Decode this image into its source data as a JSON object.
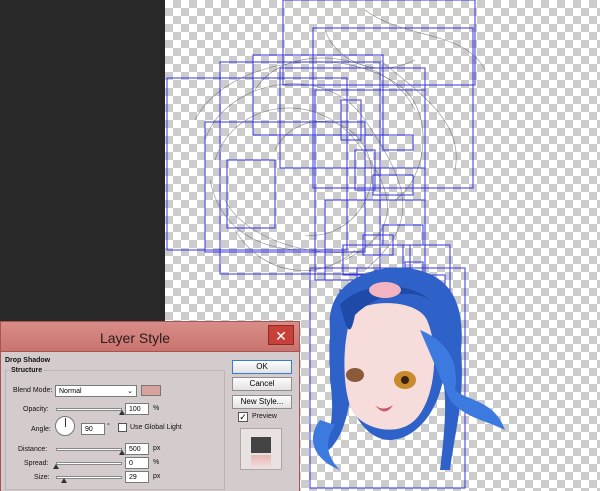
{
  "dialog": {
    "title": "Layer Style",
    "close_symbol": "✕",
    "section_title": "Drop Shadow",
    "group_title": "Structure",
    "blend_mode_label": "Blend Mode:",
    "blend_mode_value": "Normal",
    "shadow_color": "#d6a29b",
    "opacity_label": "Opacity:",
    "opacity_value": "100",
    "opacity_unit": "%",
    "opacity_level": 1.0,
    "angle_label": "Angle:",
    "angle_value": "90",
    "angle_unit": "°",
    "global_light_label": "Use Global Light",
    "distance_label": "Distance:",
    "distance_value": "500",
    "distance_unit": "px",
    "distance_level": 1.0,
    "spread_label": "Spread:",
    "spread_value": "0",
    "spread_unit": "%",
    "spread_level": 0.0,
    "size_label": "Size:",
    "size_value": "29",
    "size_unit": "px",
    "size_level": 0.12,
    "ok_label": "OK",
    "cancel_label": "Cancel",
    "new_style_label": "New Style...",
    "preview_label": "Preview",
    "preview_checked": true
  },
  "colors": {
    "workspace": "#282828",
    "titlebar": "#d07f79",
    "selection_box": "#3434e0",
    "hair": "#3a6fd8"
  }
}
